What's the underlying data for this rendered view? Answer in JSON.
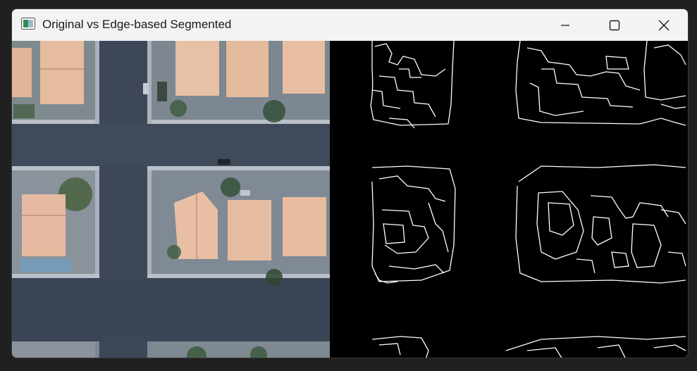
{
  "window": {
    "title": "Original vs Edge-based Segmented",
    "icon": "image-window-icon",
    "controls": {
      "minimize_icon": "minimize-icon",
      "maximize_icon": "maximize-icon",
      "close_icon": "close-icon"
    }
  },
  "panes": {
    "left": "original-aerial-image",
    "right": "edge-segmented-image"
  },
  "colors": {
    "titlebar": "#f3f3f3",
    "title_text": "#1a1a1a",
    "road": "#3f4a5a",
    "roof": "#e2b79a",
    "lawn": "#9aa3ac",
    "edge_line": "#ffffff",
    "edge_bg": "#000000"
  }
}
